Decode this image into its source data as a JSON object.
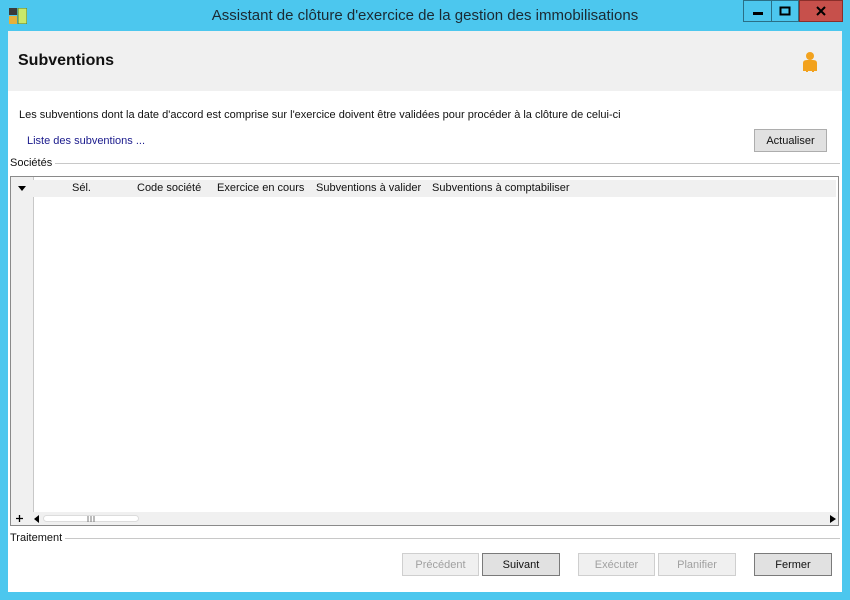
{
  "window": {
    "title": "Assistant de clôture d'exercice de la gestion des immobilisations",
    "buttons": {
      "minimize": "minimize-icon",
      "maximize": "maximize-icon",
      "close": "close-icon"
    }
  },
  "header": {
    "title": "Subventions",
    "icon": "person-icon"
  },
  "content": {
    "description": "Les subventions dont la date d'accord est comprise sur l'exercice doivent être validées pour procéder à la clôture de celui-ci",
    "list_link": "Liste des subventions ...",
    "refresh_label": "Actualiser"
  },
  "societes_group": {
    "label": "Sociétés",
    "columns": [
      "Sél.",
      "Code société",
      "Exercice en cours",
      "Subventions à valider",
      "Subventions à comptabiliser"
    ],
    "rows": []
  },
  "traitement_group": {
    "label": "Traitement"
  },
  "footer": {
    "previous_label": "Précédent",
    "next_label": "Suivant",
    "execute_label": "Exécuter",
    "schedule_label": "Planifier",
    "close_label": "Fermer"
  },
  "colors": {
    "title_bar": "#4cc7ee",
    "close_button": "#c7504b",
    "header_bg": "#f0f0f0",
    "link": "#1a1a8c"
  }
}
